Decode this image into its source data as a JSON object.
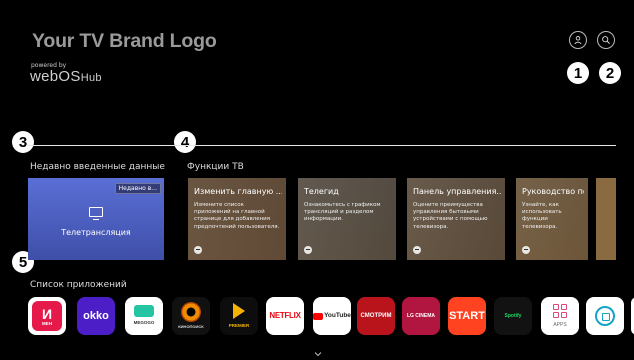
{
  "header": {
    "brand_logo": "Your TV Brand Logo",
    "powered_by": "powered by",
    "webos": "webOS",
    "webos_hub": "Hub",
    "buttons": [
      {
        "icon": "user-icon"
      },
      {
        "icon": "search-icon"
      }
    ]
  },
  "callouts": [
    "1",
    "2",
    "3",
    "4",
    "5"
  ],
  "recent": {
    "title": "Недавно введенные данные",
    "card": {
      "tag": "Недавно в...",
      "label": "Телетрансляция",
      "icon": "tv-icon"
    }
  },
  "features": {
    "title": "Функции ТВ",
    "cards": [
      {
        "title": "Изменить главную ...",
        "desc": "Измените список приложений на главной странице для добавления предпочтений пользователя."
      },
      {
        "title": "Телегид",
        "desc": "Ознакомьтесь с графиком трансляций и разделом информации."
      },
      {
        "title": "Панель управления...",
        "desc": "Оцените преимущества управления бытовыми устройствами с помощью телевизора."
      },
      {
        "title": "Руководство польз...",
        "desc": "Узнайте, как использовать функции телевизора."
      }
    ]
  },
  "apps": {
    "title": "Список приложений",
    "items": [
      {
        "name": "ivi",
        "label": "И",
        "sub": "МЕН"
      },
      {
        "name": "okko",
        "label": "okko"
      },
      {
        "name": "megogo",
        "label": "MEGOGO"
      },
      {
        "name": "kinopoisk",
        "label": "КИНОПОИСК"
      },
      {
        "name": "premier",
        "label": "PREMIER"
      },
      {
        "name": "netflix",
        "label": "NETFLIX"
      },
      {
        "name": "youtube",
        "label": "YouTube"
      },
      {
        "name": "smotrim",
        "label": "СМОТРИМ"
      },
      {
        "name": "lg-cinema",
        "label": "LG CINEMA"
      },
      {
        "name": "start",
        "label": "START"
      },
      {
        "name": "spotify",
        "label": "Spotify"
      },
      {
        "name": "apps",
        "label": "APPS"
      },
      {
        "name": "home-dashboard",
        "label": ""
      }
    ]
  },
  "footer": {
    "scroll_icon": "chevron-down-icon"
  }
}
